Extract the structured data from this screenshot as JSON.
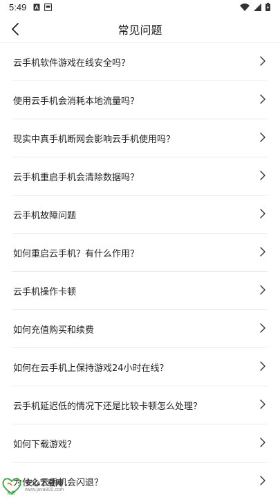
{
  "status_bar": {
    "time": "5:49"
  },
  "header": {
    "title": "常见问题",
    "back_icon": "chevron-left-icon"
  },
  "faq": {
    "items": [
      {
        "label": "云手机软件游戏在线安全吗？"
      },
      {
        "label": "使用云手机会消耗本地流量吗？"
      },
      {
        "label": "现实中真手机断网会影响云手机使用吗？"
      },
      {
        "label": "云手机重启手机会清除数据吗？"
      },
      {
        "label": "云手机故障问题"
      },
      {
        "label": "如何重启云手机？有什么作用？"
      },
      {
        "label": "云手机操作卡顿"
      },
      {
        "label": "如何充值购买和续费"
      },
      {
        "label": "如何在云手机上保持游戏24小时在线？"
      },
      {
        "label": "云手机延迟低的情况下还是比较卡顿怎么处理？"
      },
      {
        "label": "如何下载游戏？"
      },
      {
        "label": "为什么云手机会闪退？"
      }
    ],
    "chevron_icon": "chevron-right-icon"
  },
  "watermark": {
    "text": "安心下载网",
    "url": "www.java800.com",
    "badge": "免费"
  }
}
